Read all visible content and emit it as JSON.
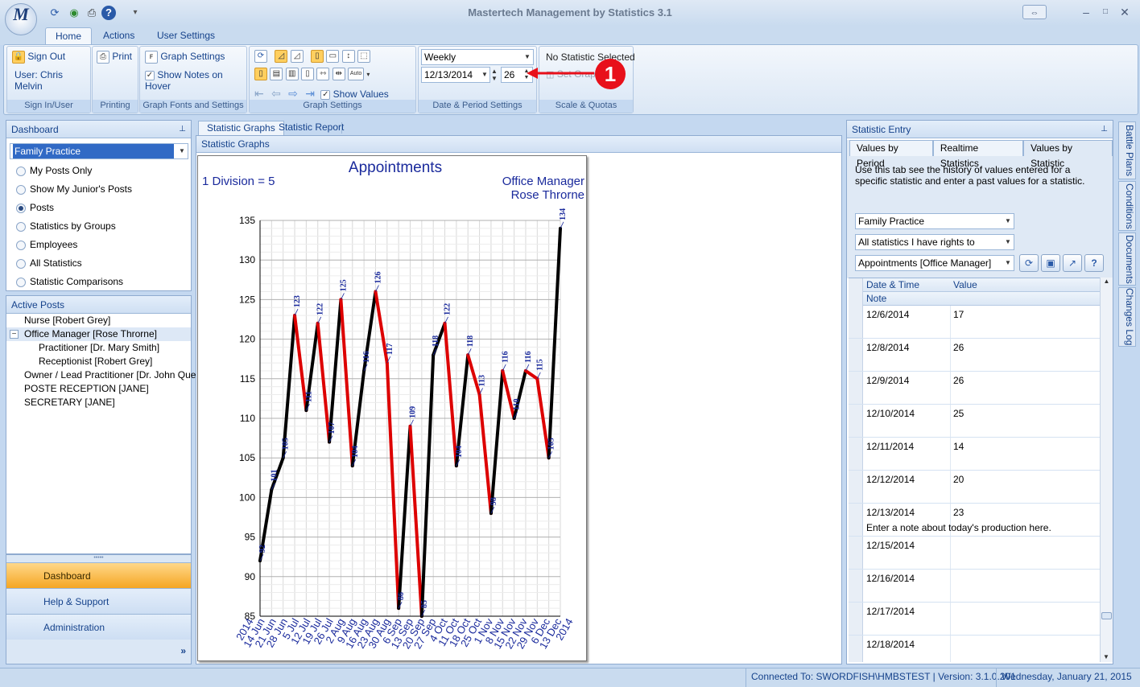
{
  "window": {
    "title": "Mastertech Management by Statistics 3.1",
    "logo": "M"
  },
  "quick_access": [
    "refresh-icon",
    "globe-icon",
    "print-icon",
    "help-icon"
  ],
  "ribbon_tabs": [
    "Home",
    "Actions",
    "User Settings"
  ],
  "ribbon": {
    "signin": {
      "signout": "Sign Out",
      "user": "User: Chris Melvin",
      "group": "Sign In/User"
    },
    "printing": {
      "print": "Print",
      "group": "Printing"
    },
    "fonts": {
      "graph_settings": "Graph Settings",
      "show_notes": "Show Notes on Hover",
      "group": "Graph Fonts and Settings"
    },
    "graph": {
      "show_values": "Show Values",
      "group": "Graph Settings",
      "auto": "Auto"
    },
    "date": {
      "period": "Weekly",
      "date": "12/13/2014",
      "count": "26",
      "group": "Date & Period Settings"
    },
    "scale": {
      "none": "No Statistic Selected",
      "set_graph": "Set Graph",
      "group": "Scale & Quotas"
    }
  },
  "annotation": {
    "marker": "1"
  },
  "dashboard": {
    "title": "Dashboard",
    "selected": "Family Practice",
    "radios": [
      "My Posts Only",
      "Show My Junior's Posts",
      "Posts",
      "Statistics by Groups",
      "Employees",
      "All Statistics",
      "Statistic Comparisons"
    ],
    "selected_radio": 2
  },
  "active_posts": {
    "title": "Active Posts",
    "items": [
      {
        "label": "Nurse [Robert Grey]",
        "indent": 0
      },
      {
        "label": "Office Manager [Rose Throrne]",
        "indent": 0,
        "toggle": "−",
        "selected": true
      },
      {
        "label": "Practitioner  [Dr. Mary Smith]",
        "indent": 1
      },
      {
        "label": "Receptionist  [Robert Grey]",
        "indent": 1
      },
      {
        "label": "Owner / Lead Practitioner  [Dr. John Que]",
        "indent": 0
      },
      {
        "label": "POSTE RECEPTION [JANE]",
        "indent": 0
      },
      {
        "label": "SECRETARY [JANE]",
        "indent": 0
      }
    ]
  },
  "nav": {
    "dashboard": "Dashboard",
    "help": "Help & Support",
    "admin": "Administration",
    "chevron": "»"
  },
  "doc_tabs": [
    "Statistic Graphs",
    "Statistic Report"
  ],
  "graph_panel_title": "Statistic Graphs",
  "chart_data": {
    "type": "line",
    "title": "Appointments",
    "division_note": "1 Division = 5",
    "post": "Office Manager",
    "person": "Rose Throrne",
    "ylim": [
      85,
      135
    ],
    "yticks": [
      85,
      90,
      95,
      100,
      105,
      110,
      115,
      120,
      125,
      130,
      135
    ],
    "x_labels": [
      "2014",
      "14 Jun",
      "21 Jun",
      "28 Jun",
      "5 Jul",
      "12 Jul",
      "19 Jul",
      "26 Jul",
      "2 Aug",
      "9 Aug",
      "16 Aug",
      "23 Aug",
      "30 Aug",
      "6 Sep",
      "13 Sep",
      "20 Sep",
      "27 Sep",
      "4 Oct",
      "11 Oct",
      "18 Oct",
      "25 Oct",
      "1 Nov",
      "8 Nov",
      "15 Nov",
      "22 Nov",
      "29 Nov",
      "6 Dec",
      "13 Dec",
      "2014"
    ],
    "values": [
      92,
      101,
      105,
      123,
      111,
      122,
      107,
      125,
      104,
      116,
      126,
      117,
      86,
      109,
      85,
      118,
      122,
      104,
      118,
      113,
      98,
      116,
      110,
      116,
      115,
      105,
      134
    ],
    "up_color": "#000000",
    "down_color": "#dd0000",
    "label_color": "#1a2a9c"
  },
  "stat_entry": {
    "title": "Statistic Entry",
    "tabs": [
      "Values by Period",
      "Realtime Statistics",
      "Values by Statistic"
    ],
    "description": "Use this tab see the history of values entered for a specific statistic and enter a past values for a statistic.",
    "selects": [
      "Family Practice",
      "All statistics I have rights to",
      "Appointments [Office Manager]"
    ],
    "toolbar": [
      "refresh-icon",
      "save-icon",
      "export-icon",
      "help-icon"
    ],
    "columns": {
      "date": "Date & Time",
      "value": "Value",
      "note": "Note"
    },
    "rows": [
      {
        "date": "12/6/2014",
        "value": "17",
        "note": ""
      },
      {
        "date": "12/8/2014",
        "value": "26",
        "note": ""
      },
      {
        "date": "12/9/2014",
        "value": "26",
        "note": ""
      },
      {
        "date": "12/10/2014",
        "value": "25",
        "note": ""
      },
      {
        "date": "12/11/2014",
        "value": "14",
        "note": ""
      },
      {
        "date": "12/12/2014",
        "value": "20",
        "note": ""
      },
      {
        "date": "12/13/2014",
        "value": "23",
        "note": "Enter a note about today's production here."
      },
      {
        "date": "12/15/2014",
        "value": "",
        "note": ""
      },
      {
        "date": "12/16/2014",
        "value": "",
        "note": ""
      },
      {
        "date": "12/17/2014",
        "value": "",
        "note": ""
      },
      {
        "date": "12/18/2014",
        "value": "",
        "note": ""
      }
    ]
  },
  "side_tabs": [
    "Battle Plans",
    "Conditions",
    "Documents",
    "Changes Log"
  ],
  "status": {
    "connection": "Connected To: SWORDFISH\\HMBSTEST | Version: 3.1.0.201",
    "date": "Wednesday, January 21, 2015"
  }
}
